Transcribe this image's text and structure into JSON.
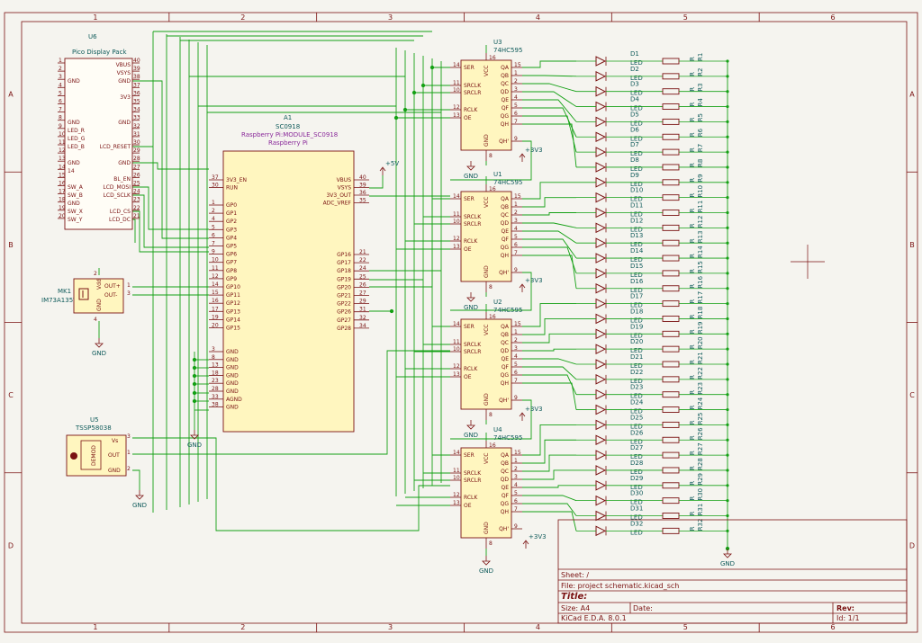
{
  "border": {
    "columns": [
      "1",
      "2",
      "3",
      "4",
      "5",
      "6"
    ],
    "rows": [
      "A",
      "B",
      "C",
      "D"
    ]
  },
  "colors": {
    "wire": "#14a014",
    "body": "#fff6bf",
    "outline": "#7a1212",
    "text_ref": "#0e5a5a",
    "junction": "#14a014"
  },
  "u6": {
    "ref": "U6",
    "value": "Pico Display Pack",
    "left_pins": [
      "GND",
      "GND",
      "LED_R",
      "LED_G",
      "LED_B",
      "GND",
      "14",
      "SW_A",
      "SW_B",
      "GND",
      "SW_X",
      "SW_Y"
    ],
    "right_pins": [
      "VBUS",
      "VSYS",
      "GND",
      "3V3",
      "GND",
      "LCD_RESET",
      "GND",
      "BL_EN",
      "LCD_MOSI",
      "LCD_SCLK",
      "LCD_CS",
      "LCD_DC"
    ],
    "right_nums": [
      "40",
      "39",
      "38",
      "37",
      "36",
      "35",
      "34",
      "33",
      "32",
      "31",
      "30",
      "29",
      "28",
      "27",
      "26",
      "25",
      "24",
      "23",
      "22",
      "21"
    ],
    "left_nums": [
      "1",
      "2",
      "3",
      "4",
      "5",
      "6",
      "7",
      "8",
      "9",
      "10",
      "11",
      "12",
      "13",
      "14",
      "15",
      "16",
      "17",
      "18",
      "19",
      "20"
    ]
  },
  "a1": {
    "ref": "A1",
    "value": "SC0918",
    "footprint": "Raspberry Pi:MODULE_SC0918",
    "vendor": "Raspberry Pi",
    "left_pins": [
      {
        "n": "37",
        "name": "3V3_EN"
      },
      {
        "n": "30",
        "name": "RUN"
      },
      {
        "n": "1",
        "name": "GP0"
      },
      {
        "n": "2",
        "name": "GP1"
      },
      {
        "n": "4",
        "name": "GP2"
      },
      {
        "n": "5",
        "name": "GP3"
      },
      {
        "n": "6",
        "name": "GP4"
      },
      {
        "n": "7",
        "name": "GP5"
      },
      {
        "n": "9",
        "name": "GP6"
      },
      {
        "n": "10",
        "name": "GP7"
      },
      {
        "n": "11",
        "name": "GP8"
      },
      {
        "n": "12",
        "name": "GP9"
      },
      {
        "n": "14",
        "name": "GP10"
      },
      {
        "n": "15",
        "name": "GP11"
      },
      {
        "n": "16",
        "name": "GP12"
      },
      {
        "n": "17",
        "name": "GP13"
      },
      {
        "n": "19",
        "name": "GP14"
      },
      {
        "n": "20",
        "name": "GP15"
      }
    ],
    "gnd_pins": [
      {
        "n": "3",
        "name": "GND"
      },
      {
        "n": "8",
        "name": "GND"
      },
      {
        "n": "13",
        "name": "GND"
      },
      {
        "n": "18",
        "name": "GND"
      },
      {
        "n": "23",
        "name": "GND"
      },
      {
        "n": "28",
        "name": "GND"
      },
      {
        "n": "33",
        "name": "AGND"
      },
      {
        "n": "38",
        "name": "GND"
      }
    ],
    "right_top": [
      {
        "n": "40",
        "name": "VBUS"
      },
      {
        "n": "39",
        "name": "VSYS"
      },
      {
        "n": "36",
        "name": "3V3_OUT"
      },
      {
        "n": "35",
        "name": "ADC_VREF"
      }
    ],
    "right_gp": [
      {
        "n": "21",
        "name": "GP16"
      },
      {
        "n": "22",
        "name": "GP17"
      },
      {
        "n": "24",
        "name": "GP18"
      },
      {
        "n": "25",
        "name": "GP19"
      },
      {
        "n": "26",
        "name": "GP20"
      },
      {
        "n": "27",
        "name": "GP21"
      },
      {
        "n": "29",
        "name": "GP22"
      },
      {
        "n": "31",
        "name": "GP26"
      },
      {
        "n": "32",
        "name": "GP27"
      },
      {
        "n": "34",
        "name": "GP28"
      }
    ]
  },
  "mk1": {
    "ref": "MK1",
    "value": "IM73A135V01",
    "pins": [
      "OUT+",
      "OUT-"
    ],
    "vdd": "Vdd",
    "gnd": "GND",
    "nums": [
      "2",
      "1",
      "3",
      "4"
    ]
  },
  "u5": {
    "ref": "U5",
    "value": "TSSP58038",
    "pins": [
      "Vs",
      "OUT",
      "GND"
    ],
    "body": "DEMOD",
    "nums": [
      "3",
      "1",
      "2"
    ]
  },
  "shift_regs": [
    {
      "ref": "U3",
      "value": "74HC595"
    },
    {
      "ref": "U1",
      "value": "74HC595"
    },
    {
      "ref": "U2",
      "value": "74HC595"
    },
    {
      "ref": "U4",
      "value": "74HC595"
    }
  ],
  "sr_pins": {
    "left": [
      {
        "n": "14",
        "name": "SER"
      },
      {
        "n": "11",
        "name": "SRCLK"
      },
      {
        "n": "10",
        "name": "SRCLR"
      },
      {
        "n": "12",
        "name": "RCLK"
      },
      {
        "n": "13",
        "name": "OE"
      }
    ],
    "right": [
      {
        "n": "15",
        "name": "QA"
      },
      {
        "n": "1",
        "name": "QB"
      },
      {
        "n": "2",
        "name": "QC"
      },
      {
        "n": "3",
        "name": "QD"
      },
      {
        "n": "4",
        "name": "QE"
      },
      {
        "n": "5",
        "name": "QF"
      },
      {
        "n": "6",
        "name": "QG"
      },
      {
        "n": "7",
        "name": "QH"
      },
      {
        "n": "9",
        "name": "QH'"
      }
    ],
    "vcc": "VCC",
    "gnd": "GND",
    "vcc_num": "16",
    "gnd_num": "8"
  },
  "leds": {
    "prefix": "D",
    "count": 32,
    "value": "LED"
  },
  "resistors": {
    "prefix": "R",
    "count": 32,
    "value": "R"
  },
  "power": {
    "plus5": "+5V",
    "plus3v3": "+3V3",
    "gnd": "GND"
  },
  "title_block": {
    "sheet_label": "Sheet: /",
    "file_label": "File: project schematic.kicad_sch",
    "title_label": "Title:",
    "size_label": "Size: A4",
    "date_label": "Date:",
    "rev_label": "Rev:",
    "kicad_label": "KiCad E.D.A. 8.0.1",
    "id_label": "Id: 1/1"
  }
}
